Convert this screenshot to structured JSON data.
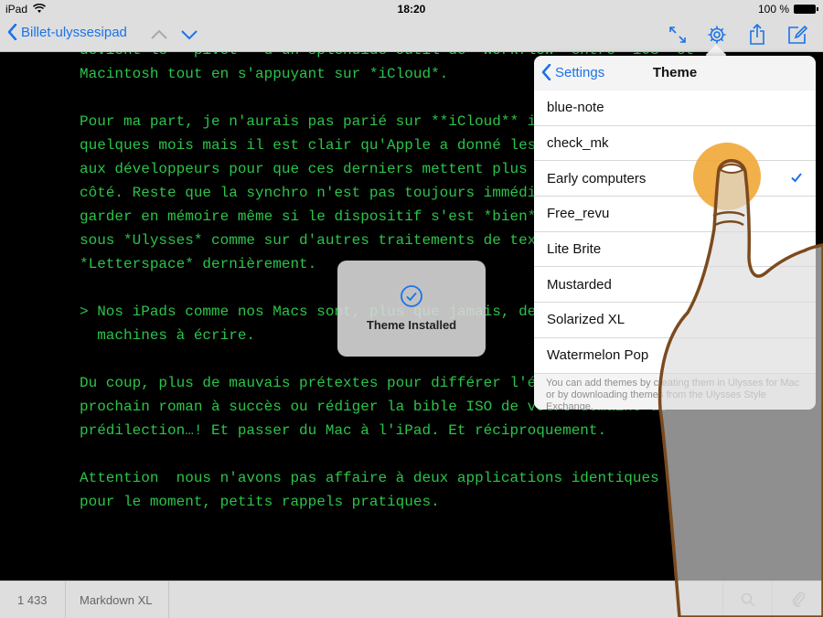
{
  "status": {
    "device": "iPad",
    "time": "18:20",
    "battery": "100 %"
  },
  "toolbar": {
    "back_label": "Billet-ulyssesipad"
  },
  "editor": {
    "text": "devient le **pivot** d'un splendide outil de *workflow* entre *iOS* et\nMacintosh tout en s'appuyant sur *iCloud*.\n\nPour ma part, je n'aurais pas parié sur **iCloud** il y a encore\nquelques mois mais il est clair qu'Apple a donné les moyens\naux développeurs pour que ces derniers mettent plus d'énergie de ce\ncôté. Reste que la synchro n'est pas toujours immédiate. A\ngarder en mémoire même si le dispositif s'est *bien* amélioré\nsous *Ulysses* comme sur d'autres traitements de texte comme\n*Letterspace* dernièrement.\n\n> Nos iPads comme nos Macs sont, plus que jamais, de parfaites\n  machines à écrire.\n\nDu coup, plus de mauvais prétextes pour différer l'écriture de votre\nprochain roman à succès ou rédiger la bible ISO de votre domaine de\nprédilection…! Et passer du Mac à l'iPad. Et réciproquement.\n\nAttention  nous n'avons pas affaire à deux applications identiques\npour le moment, petits rappels pratiques."
  },
  "footer": {
    "word_count": "1 433",
    "format": "Markdown XL"
  },
  "hud": {
    "message": "Theme Installed"
  },
  "popover": {
    "back_label": "Settings",
    "title": "Theme",
    "themes": [
      "blue-note",
      "check_mk",
      "Early computers",
      "Free_revu",
      "Lite Brite",
      "Mustarded",
      "Solarized XL",
      "Watermelon Pop"
    ],
    "selected": "Early computers",
    "footnote": "You can add themes by creating them in Ulysses for Mac or by downloading themes from the Ulysses Style Exchange."
  },
  "colors": {
    "accent": "#1a73e8",
    "editor_text": "#2bc44a",
    "editor_bg": "#000000",
    "touch": "#f0a93a"
  },
  "icons": {
    "back": "chevron-left-icon",
    "prev": "chevron-up-icon",
    "next": "chevron-down-icon",
    "fullscreen": "expand-icon",
    "settings": "gear-icon",
    "share": "share-icon",
    "compose": "compose-icon",
    "search": "search-icon",
    "attach": "paperclip-icon",
    "checkmark": "checkmark-icon",
    "success": "checkmark-circle-icon"
  }
}
